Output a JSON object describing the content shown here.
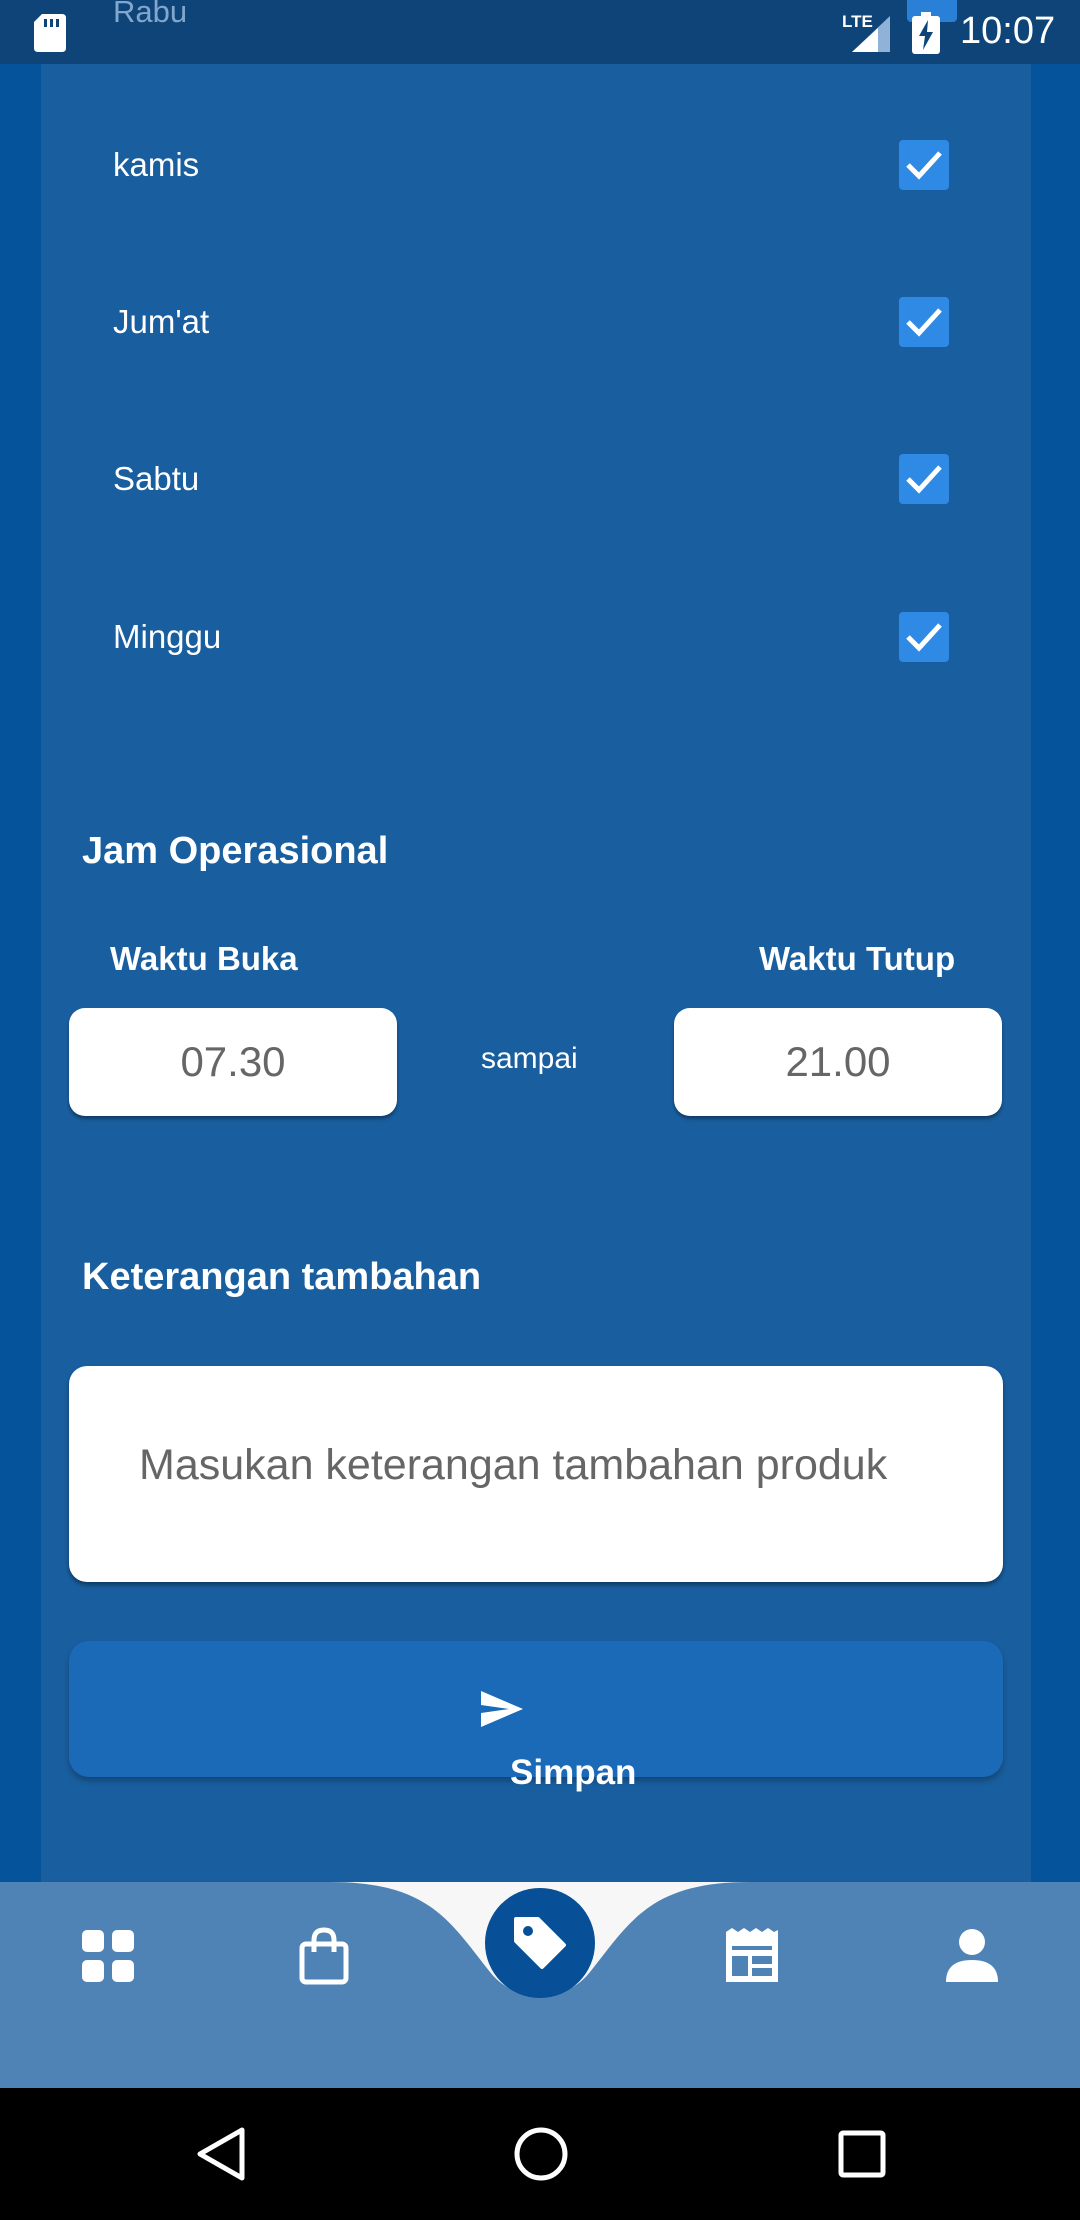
{
  "status_bar": {
    "time": "10:07",
    "network": "LTE",
    "icons": [
      "sd-card-icon",
      "signal-icon",
      "battery-charging-icon"
    ]
  },
  "days": {
    "partial_top": "Rabu",
    "items": [
      {
        "label": "kamis",
        "checked": true
      },
      {
        "label": "Jum'at",
        "checked": true
      },
      {
        "label": "Sabtu",
        "checked": true
      },
      {
        "label": "Minggu",
        "checked": true
      }
    ]
  },
  "hours": {
    "title": "Jam Operasional",
    "open_label": "Waktu Buka",
    "close_label": "Waktu Tutup",
    "open_value": "07.30",
    "close_value": "21.00",
    "separator": "sampai"
  },
  "notes": {
    "title": "Keterangan tambahan",
    "placeholder": "Masukan keterangan tambahan produk"
  },
  "save_button": {
    "label": "Simpan",
    "icon": "send-icon"
  },
  "bottom_nav": {
    "items": [
      "dashboard-icon",
      "shopping-bag-icon",
      "tag-icon",
      "receipt-icon",
      "profile-icon"
    ],
    "active": "tag-icon"
  },
  "system_nav": {
    "items": [
      "back-icon",
      "home-icon",
      "recents-icon"
    ]
  },
  "colors": {
    "background": "#05539a",
    "card": "#195e9f",
    "checkbox": "#2f8ae6",
    "button": "#1a6ab8",
    "nav": "#5083b5"
  }
}
